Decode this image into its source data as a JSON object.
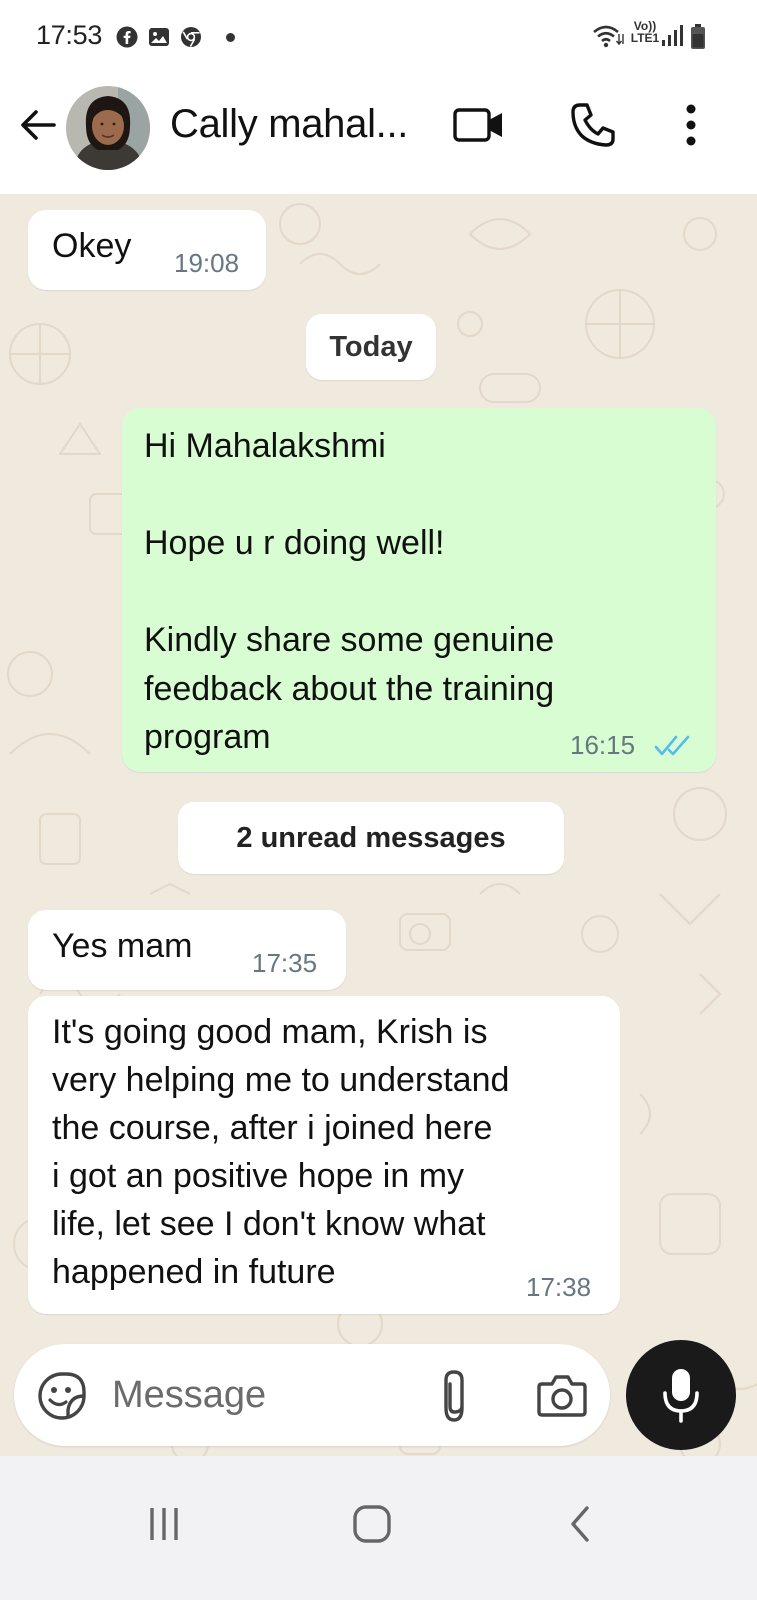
{
  "status_bar": {
    "time": "17:53",
    "network_label": "Vo)) LTE1",
    "notification_icons": [
      "facebook-icon",
      "gallery-icon",
      "chrome-icon"
    ]
  },
  "header": {
    "contact_name": "Cally mahal...",
    "actions": [
      "video-call-icon",
      "phone-icon",
      "more-options-icon"
    ]
  },
  "messages": [
    {
      "direction": "incoming",
      "text": "Okey",
      "time": "19:08"
    },
    {
      "direction": "outgoing",
      "text": "Hi Mahalakshmi\n\nHope u r doing well!\n\nKindly share some genuine\nfeedback about the training\nprogram",
      "time": "16:15",
      "status": "read"
    },
    {
      "direction": "incoming",
      "text": "Yes mam",
      "time": "17:35"
    },
    {
      "direction": "incoming",
      "text": "It's going good mam,  Krish is\nvery helping me to understand\nthe course, after i joined here\ni got an positive hope in my\nlife, let see I don't know what\nhappened in future",
      "time": "17:38"
    }
  ],
  "date_divider": "Today",
  "unread_divider": "2 unread messages",
  "composer": {
    "placeholder": "Message"
  },
  "colors": {
    "chat_background": "#efe9de",
    "outgoing_bubble": "#d9fdd3",
    "incoming_bubble": "#ffffff",
    "read_ticks": "#53bdeb",
    "mic_button": "#1a1a1a"
  }
}
